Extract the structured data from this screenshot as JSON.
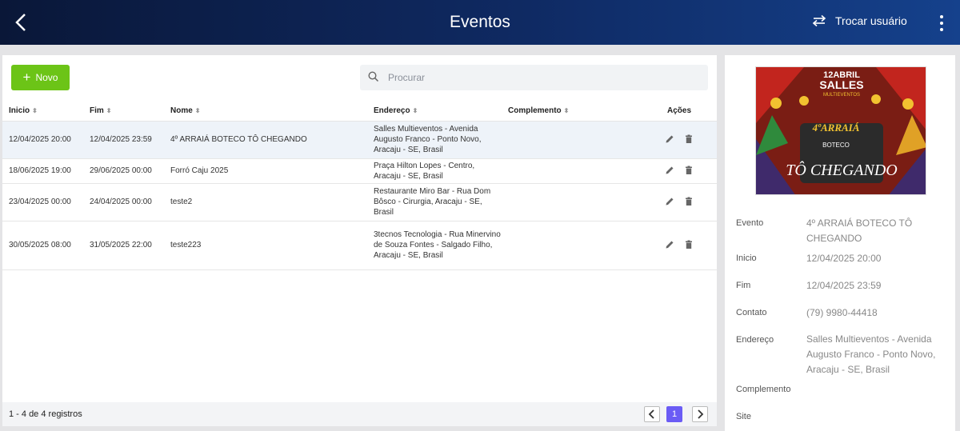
{
  "header": {
    "title": "Eventos",
    "switch_user_label": "Trocar usuário"
  },
  "toolbar": {
    "new_label": "Novo",
    "search_placeholder": "Procurar"
  },
  "table": {
    "columns": [
      "Inicio",
      "Fim",
      "Nome",
      "Endereço",
      "Complemento",
      "Ações"
    ],
    "rows": [
      {
        "inicio": "12/04/2025 20:00",
        "fim": "12/04/2025 23:59",
        "nome": "4º ARRAIÁ BOTECO TÔ CHEGANDO",
        "endereco": "Salles Multieventos - Avenida Augusto Franco - Ponto Novo, Aracaju - SE, Brasil",
        "complemento": ""
      },
      {
        "inicio": "18/06/2025 19:00",
        "fim": "29/06/2025 00:00",
        "nome": "Forró Caju 2025",
        "endereco": "Praça Hilton Lopes - Centro, Aracaju - SE, Brasil",
        "complemento": ""
      },
      {
        "inicio": "23/04/2025 00:00",
        "fim": "24/04/2025 00:00",
        "nome": "teste2",
        "endereco": "Restaurante Miro Bar - Rua Dom Bôsco - Cirurgia, Aracaju - SE, Brasil",
        "complemento": ""
      },
      {
        "inicio": "30/05/2025 08:00",
        "fim": "31/05/2025 22:00",
        "nome": "teste223",
        "endereco": "3tecnos Tecnologia - Rua Minervino de Souza Fontes - Salgado Filho, Aracaju - SE, Brasil",
        "complemento": ""
      }
    ]
  },
  "footer": {
    "records": "1 - 4 de 4 registros",
    "current_page": "1"
  },
  "poster": {
    "line1": "12ABRIL",
    "line2": "SALLES",
    "line3": "MULTIEVENTOS",
    "line4": "4ºARRAIÁ",
    "line5": "BOTECO",
    "line6": "TÔ CHEGANDO"
  },
  "details": {
    "evento_label": "Evento",
    "evento": "4º ARRAIÁ BOTECO TÔ CHEGANDO",
    "inicio_label": "Inicio",
    "inicio": "12/04/2025 20:00",
    "fim_label": "Fim",
    "fim": "12/04/2025 23:59",
    "contato_label": "Contato",
    "contato": "(79) 9980-44418",
    "endereco_label": "Endereço",
    "endereco": "Salles Multieventos - Avenida Augusto Franco - Ponto Novo, Aracaju - SE, Brasil",
    "complemento_label": "Complemento",
    "complemento": "",
    "site_label": "Site",
    "site": ""
  },
  "colors": {
    "header_dark": "#0a1738",
    "header_light": "#15418c",
    "new_button": "#6cc417",
    "active_page": "#6b5cf5",
    "selected_row": "#eef3f9"
  },
  "icons": [
    "back-arrow-icon",
    "swap-icon",
    "more-vertical-icon",
    "plus-icon",
    "search-icon",
    "sort-icon",
    "edit-pencil-icon",
    "trash-icon",
    "chevron-left-icon",
    "chevron-right-icon"
  ]
}
